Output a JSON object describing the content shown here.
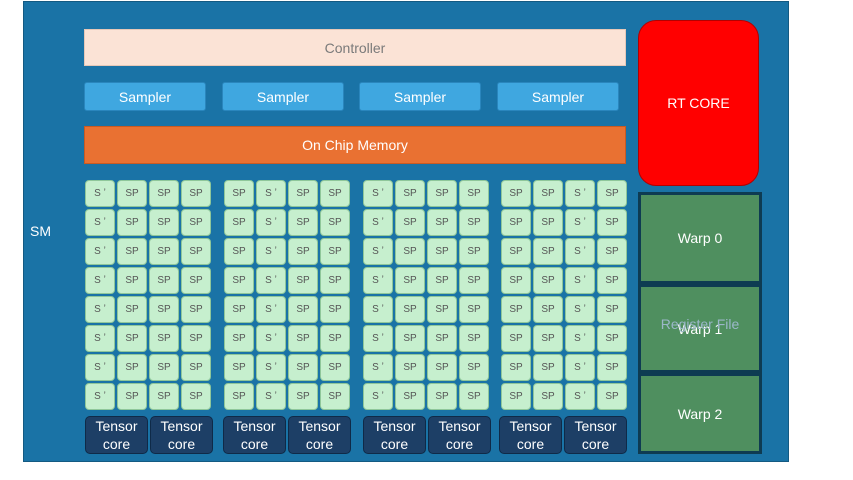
{
  "sm": {
    "label": "SM",
    "controller": "Controller",
    "samplers": [
      "Sampler",
      "Sampler",
      "Sampler",
      "Sampler"
    ],
    "on_chip_memory": "On Chip Memory",
    "sp_blocks": [
      {
        "rows": [
          [
            "S ʼ",
            "SP",
            "SP",
            "SP"
          ],
          [
            "S ʼ",
            "SP",
            "SP",
            "SP"
          ],
          [
            "S ʼ",
            "SP",
            "SP",
            "SP"
          ],
          [
            "S ʼ",
            "SP",
            "SP",
            "SP"
          ],
          [
            "S ʼ",
            "SP",
            "SP",
            "SP"
          ],
          [
            "S ʼ",
            "SP",
            "SP",
            "SP"
          ],
          [
            "S ʼ",
            "SP",
            "SP",
            "SP"
          ],
          [
            "S ʼ",
            "SP",
            "SP",
            "SP"
          ]
        ]
      },
      {
        "rows": [
          [
            "SP",
            "S ʼ",
            "SP",
            "SP"
          ],
          [
            "SP",
            "S ʼ",
            "SP",
            "SP"
          ],
          [
            "SP",
            "S ʼ",
            "SP",
            "SP"
          ],
          [
            "SP",
            "S ʼ",
            "SP",
            "SP"
          ],
          [
            "SP",
            "S ʼ",
            "SP",
            "SP"
          ],
          [
            "SP",
            "S ʼ",
            "SP",
            "SP"
          ],
          [
            "SP",
            "S ʼ",
            "SP",
            "SP"
          ],
          [
            "SP",
            "S ʼ",
            "SP",
            "SP"
          ]
        ]
      },
      {
        "rows": [
          [
            "S ʼ",
            "SP",
            "SP",
            "SP"
          ],
          [
            "S ʼ",
            "SP",
            "SP",
            "SP"
          ],
          [
            "S ʼ",
            "SP",
            "SP",
            "SP"
          ],
          [
            "S ʼ",
            "SP",
            "SP",
            "SP"
          ],
          [
            "S ʼ",
            "SP",
            "SP",
            "SP"
          ],
          [
            "S ʼ",
            "SP",
            "SP",
            "SP"
          ],
          [
            "S ʼ",
            "SP",
            "SP",
            "SP"
          ],
          [
            "S ʼ",
            "SP",
            "SP",
            "SP"
          ]
        ]
      },
      {
        "rows": [
          [
            "SP",
            "SP",
            "S ʼ",
            "SP"
          ],
          [
            "SP",
            "SP",
            "S ʼ",
            "SP"
          ],
          [
            "SP",
            "SP",
            "S ʼ",
            "SP"
          ],
          [
            "SP",
            "SP",
            "S ʼ",
            "SP"
          ],
          [
            "SP",
            "SP",
            "S ʼ",
            "SP"
          ],
          [
            "SP",
            "SP",
            "S ʼ",
            "SP"
          ],
          [
            "SP",
            "SP",
            "S ʼ",
            "SP"
          ],
          [
            "SP",
            "SP",
            "S ʼ",
            "SP"
          ]
        ]
      }
    ],
    "tensor_cores": [
      "Tensor\ncore",
      "Tensor\ncore",
      "Tensor\ncore",
      "Tensor\ncore",
      "Tensor\ncore",
      "Tensor\ncore",
      "Tensor\ncore",
      "Tensor\ncore"
    ],
    "rt_core": "RT CORE",
    "register_file": "Register File",
    "warps": [
      "Warp 0",
      "Warp 1",
      "Warp 2"
    ]
  },
  "colors": {
    "sm_bg": "#1a73a6",
    "controller": "#fbe3d6",
    "sampler": "#3fa7e0",
    "on_chip_memory": "#e97132",
    "sp": "#c6efce",
    "tensor_core": "#1d3f66",
    "rt_core": "#ff0000",
    "warp": "#4f8f5f"
  }
}
